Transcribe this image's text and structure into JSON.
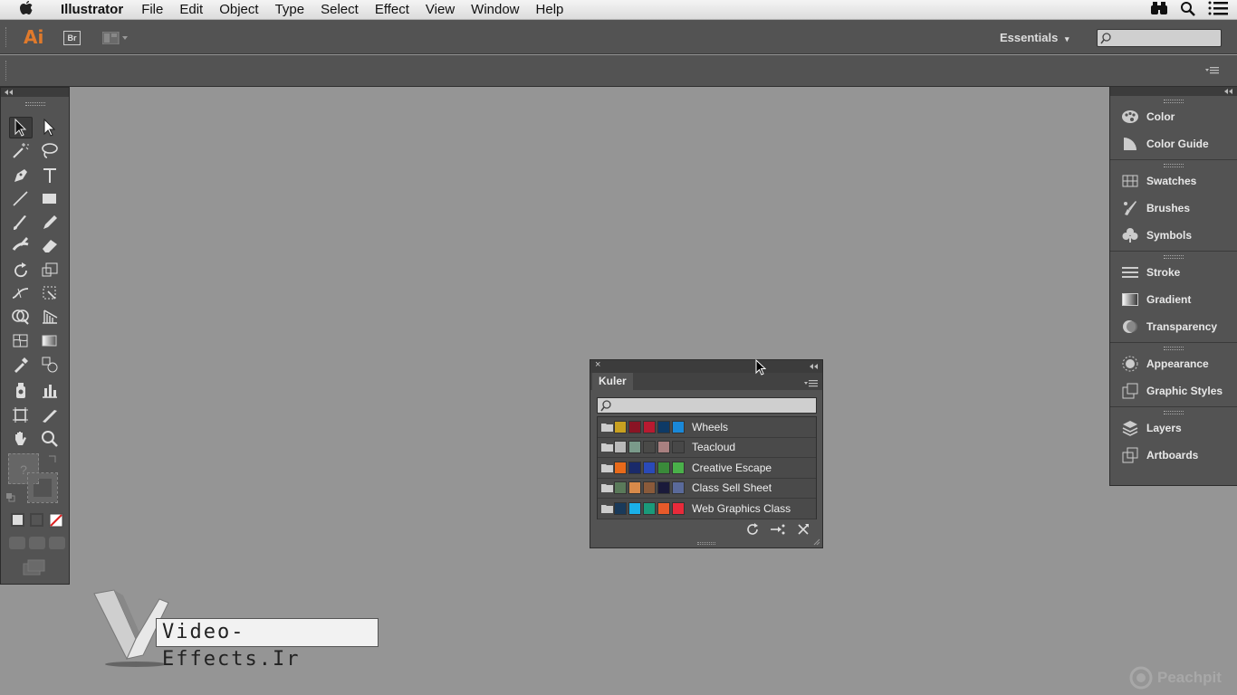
{
  "menubar": {
    "app_name": "Illustrator",
    "items": [
      "File",
      "Edit",
      "Object",
      "Type",
      "Select",
      "Effect",
      "View",
      "Window",
      "Help"
    ]
  },
  "appbar": {
    "logo": "Ai",
    "bridge": "Br",
    "workspace": "Essentials",
    "search_placeholder": ""
  },
  "dock": {
    "groups": [
      [
        {
          "label": "Color",
          "icon": "palette-icon"
        },
        {
          "label": "Color Guide",
          "icon": "color-guide-icon"
        }
      ],
      [
        {
          "label": "Swatches",
          "icon": "swatches-grid-icon"
        },
        {
          "label": "Brushes",
          "icon": "brushes-icon"
        },
        {
          "label": "Symbols",
          "icon": "club-symbol-icon"
        }
      ],
      [
        {
          "label": "Stroke",
          "icon": "stroke-lines-icon"
        },
        {
          "label": "Gradient",
          "icon": "gradient-icon"
        },
        {
          "label": "Transparency",
          "icon": "transparency-icon"
        }
      ],
      [
        {
          "label": "Appearance",
          "icon": "appearance-sun-icon"
        },
        {
          "label": "Graphic Styles",
          "icon": "graphic-styles-icon"
        }
      ],
      [
        {
          "label": "Layers",
          "icon": "layers-icon"
        },
        {
          "label": "Artboards",
          "icon": "artboards-icon"
        }
      ]
    ]
  },
  "kuler": {
    "tab_label": "Kuler",
    "themes": [
      {
        "name": "Wheels",
        "colors": [
          "#c8a020",
          "#8a1424",
          "#b81a30",
          "#0e3a66",
          "#1a88d8"
        ]
      },
      {
        "name": "Teacloud",
        "colors": [
          "#b8b8b8",
          "#7a9a8a",
          "#4a4a48",
          "#a88080",
          "#484848"
        ]
      },
      {
        "name": "Creative Escape",
        "colors": [
          "#e86a1a",
          "#1a2a6a",
          "#2a4ab8",
          "#3a8a3a",
          "#4ab04a"
        ]
      },
      {
        "name": "Class Sell Sheet",
        "colors": [
          "#5a7a5a",
          "#d88a4a",
          "#8a5a3a",
          "#1a1a3a",
          "#5a6a9a"
        ]
      },
      {
        "name": "Web Graphics Class",
        "colors": [
          "#1a3a5a",
          "#1ab0e8",
          "#1a9a7a",
          "#e85a2a",
          "#e82a3a"
        ]
      }
    ]
  },
  "watermark": {
    "text": "Video-Effects.Ir"
  },
  "brand": {
    "text": "Peachpit"
  }
}
